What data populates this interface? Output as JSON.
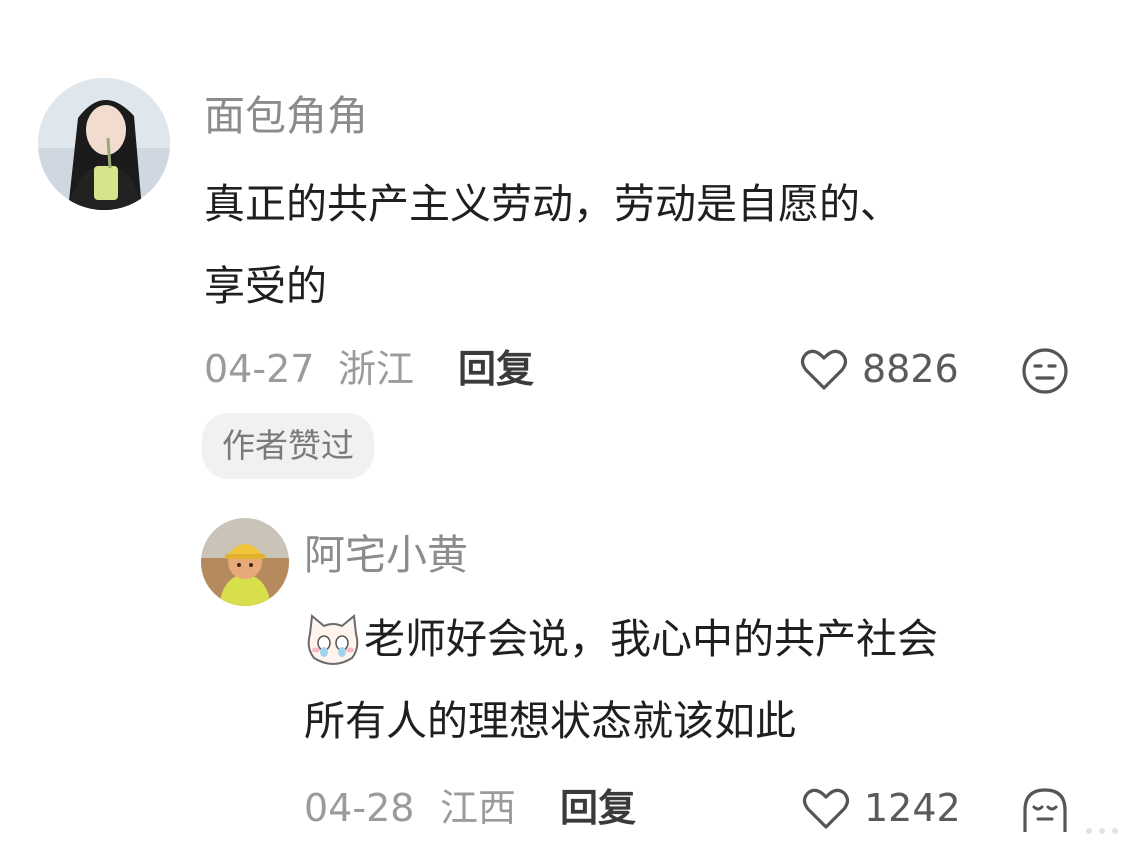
{
  "comments": [
    {
      "username": "面包角角",
      "text_lines": [
        "真正的共产主义劳动，劳动是自愿的、",
        "享受的"
      ],
      "date": "04-27",
      "location": "浙江",
      "reply_label": "回复",
      "like_count": "8826",
      "badge": "作者赞过",
      "avatar_icon": "portrait-avatar",
      "like_icon": "heart-outline-icon",
      "react_icon": "neutral-face-icon"
    },
    {
      "username": "阿宅小黄",
      "text_lines": [
        "老师好会说，我心中的共产社会",
        "所有人的理想状态就该如此"
      ],
      "emoji_icon": "crying-cat-emoji-icon",
      "date": "04-28",
      "location": "江西",
      "reply_label": "回复",
      "like_count": "1242",
      "avatar_icon": "cartoon-worker-avatar",
      "like_icon": "heart-outline-icon",
      "react_icon": "sleepy-face-icon"
    }
  ],
  "colors": {
    "username": "#8c8c8c",
    "text": "#1f1f1f",
    "meta": "#9b9b9b",
    "badge_bg": "#f1f1f1"
  }
}
